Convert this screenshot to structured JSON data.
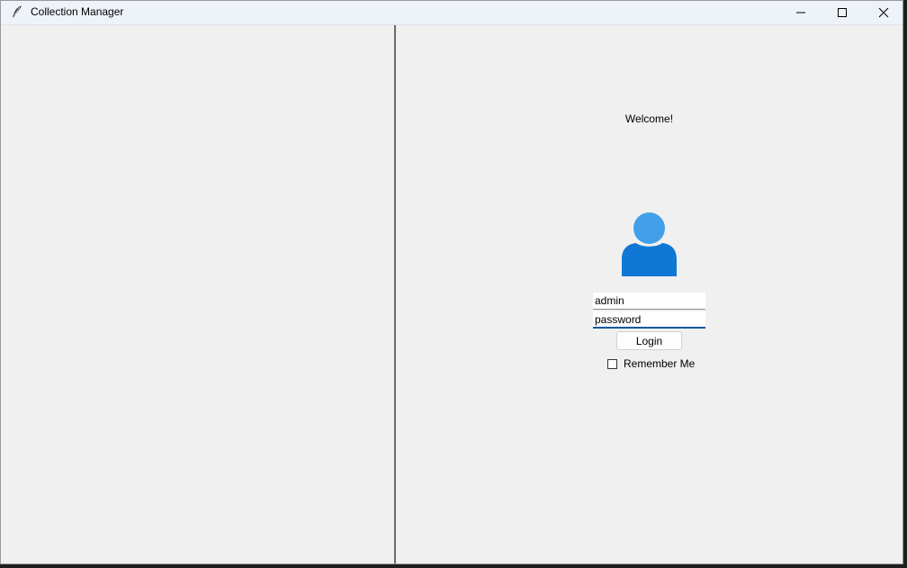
{
  "window": {
    "title": "Collection Manager",
    "icons": {
      "app": "feather-icon",
      "minimize": "minimize-icon",
      "maximize": "maximize-icon",
      "close": "close-icon"
    }
  },
  "login": {
    "welcome_text": "Welcome!",
    "avatar_icon": "user-icon",
    "username_value": "admin",
    "password_value": "password",
    "login_label": "Login",
    "remember_label": "Remember Me",
    "remember_checked": false
  },
  "colors": {
    "avatar_head": "#42a0ea",
    "avatar_body": "#0f78d4",
    "focus_underline": "#005a9e"
  }
}
